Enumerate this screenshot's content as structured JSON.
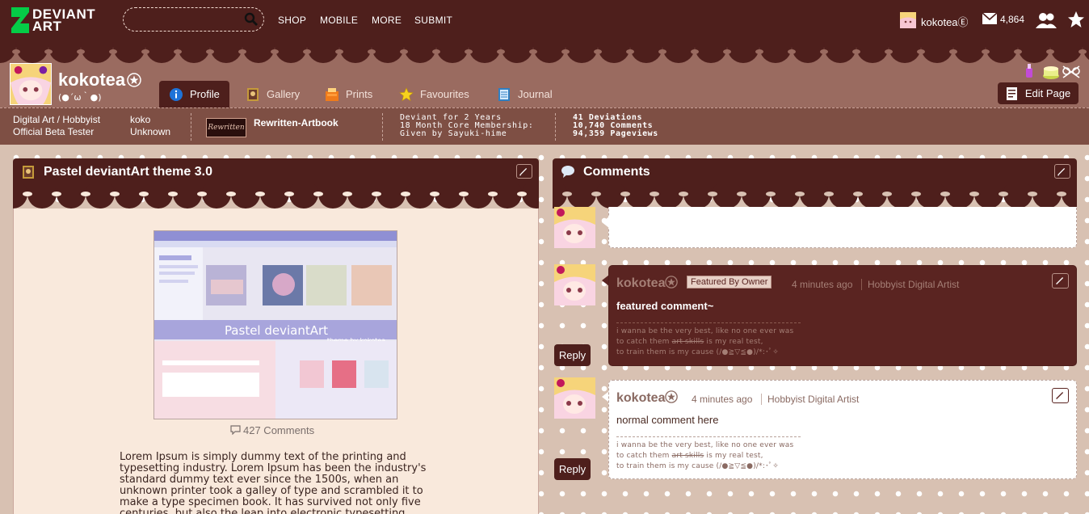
{
  "topbar": {
    "logo_line1": "DEVIANT",
    "logo_line2": "ART",
    "search": {
      "value": "",
      "placeholder": ""
    },
    "nav": [
      "SHOP",
      "MOBILE",
      "MORE",
      "SUBMIT"
    ],
    "username": "kokotea",
    "username_mark": "Ⓔ",
    "message_count": "4,864"
  },
  "profile": {
    "name": "kokotea",
    "tagline": "(●´ω｀●)",
    "tabs": [
      {
        "label": "Profile",
        "icon": "info-icon"
      },
      {
        "label": "Gallery",
        "icon": "gallery-icon"
      },
      {
        "label": "Prints",
        "icon": "prints-icon"
      },
      {
        "label": "Favourites",
        "icon": "star-icon"
      },
      {
        "label": "Journal",
        "icon": "journal-icon"
      }
    ],
    "edit_page": "Edit Page",
    "info": {
      "category_line1": "Digital Art / Hobbyist",
      "category_line2": "Official Beta Tester",
      "alias_line1": "koko",
      "alias_line2": "Unknown",
      "group_badge": "Rewritten",
      "group_name": "Rewritten-Artbook",
      "deviant_line1": "Deviant for 2 Years",
      "deviant_line2": "18 Month Core Membership:",
      "deviant_line3": "Given by Sayuki-hime",
      "stat_deviations": "41 Deviations",
      "stat_comments": "10,740 Comments",
      "stat_pageviews": "94,359 Pageviews"
    }
  },
  "left_panel": {
    "title": "Pastel deviantArt theme 3.0",
    "thumb_caption": "Pastel deviantArt",
    "thumb_subcaption": "theme by kokotea",
    "comments_count": "427 Comments",
    "lorem": "Lorem Ipsum is simply dummy text of the printing and typesetting industry. Lorem Ipsum has been the industry's standard dummy text ever since the 1500s, when an unknown printer took a galley of type and scrambled it to make a type specimen book. It has survived not only five centuries, but also the leap into electronic typesetting"
  },
  "right_panel": {
    "title": "Comments",
    "comments": [
      {
        "author": "kokotea",
        "featured_label": "Featured By Owner",
        "time": "4 minutes ago",
        "role": "Hobbyist Digital Artist",
        "text": "featured comment~",
        "sig1": "i wanna be the very best, like no one ever was",
        "sig2a": "to catch them ",
        "sig2b": "art skills",
        "sig2c": " is my real test,",
        "sig3": "to train them is my cause (/●≧▽≦●)/*:･ﾟ✧",
        "reply": "Reply"
      },
      {
        "author": "kokotea",
        "time": "4 minutes ago",
        "role": "Hobbyist Digital Artist",
        "text": "normal comment here",
        "sig1": "i wanna be the very best, like no one ever was",
        "sig2a": "to catch them ",
        "sig2b": "art skills",
        "sig2c": " is my real test,",
        "sig3": "to train them is my cause (/●≧▽≦●)/*:･ﾟ✧",
        "reply": "Reply"
      }
    ]
  },
  "colors": {
    "primary_dark": "#4e1f1c",
    "band": "#9a6b60",
    "strip": "#7e4f44",
    "background": "#d8c1b2",
    "logo_green": "#05cc47"
  }
}
